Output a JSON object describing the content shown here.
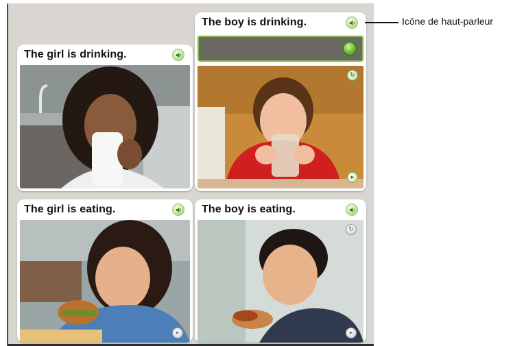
{
  "cards": [
    {
      "id": "boy-drinking",
      "caption": "The boy is drinking."
    },
    {
      "id": "girl-drinking",
      "caption": "The girl is drinking."
    },
    {
      "id": "girl-eating",
      "caption": "The girl is eating."
    },
    {
      "id": "boy-eating",
      "caption": "The boy is eating."
    }
  ],
  "annotation": {
    "label": "Icône de haut-parleur"
  },
  "icons": {
    "speaker": "speaker-icon",
    "record": "record-button-icon",
    "next": "next-arrow-icon",
    "replay": "replay-icon"
  },
  "colors": {
    "accent_green": "#6fbf2f",
    "answer_box": "#6a6a63",
    "panel_bg": "#d9d6d1"
  }
}
